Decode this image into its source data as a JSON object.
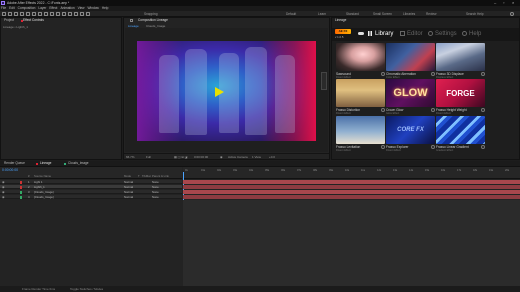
{
  "window": {
    "title": "Adobe After Effects 2022 - C:\\Fonts.aep *"
  },
  "menu": [
    "File",
    "Edit",
    "Composition",
    "Layer",
    "Effect",
    "Animation",
    "View",
    "Window",
    "Help"
  ],
  "toolbar": {
    "snapping_label": "Snapping",
    "workspaces": [
      "Default",
      "Learn",
      "Standard",
      "Small Screen",
      "Libraries",
      "Review"
    ],
    "search_label": "Search Help"
  },
  "project_panel": {
    "tabs": [
      "Project",
      "Effect Controls"
    ],
    "breadcrumb": "Lineage • Lighth_1"
  },
  "composition_panel": {
    "tab": "Composition Lineage",
    "sub_tabs": [
      "Lineage",
      "Clouds_Image"
    ],
    "zoom": "66.7%",
    "quality": "Full",
    "timecode": "0:00:00:00",
    "camera": "Active Camera",
    "views": "1 View",
    "exposure": "+0.0"
  },
  "library_panel": {
    "tab": "Lineage",
    "brand": "AE FX",
    "version": "v 1.0.5",
    "nav": [
      {
        "label": "Library",
        "active": true
      },
      {
        "label": "Editor",
        "active": false
      },
      {
        "label": "Settings",
        "active": false
      },
      {
        "label": "Help",
        "active": false
      }
    ],
    "cards": [
      {
        "title": "Sawsound",
        "sub": "Distort Effect"
      },
      {
        "title": "Chromatic Aberration",
        "sub": "Color Effect"
      },
      {
        "title": "Frasso 3D Displace",
        "sub": "Displace Effect"
      },
      {
        "title": "Frasso Distortion",
        "sub": "Distort Effect"
      },
      {
        "title": "Crown Glow",
        "sub": "Glow Effect"
      },
      {
        "title": "Frasso Height Weight",
        "sub": "Distort Effect"
      },
      {
        "title": "Frasso Levitation",
        "sub": "Distort Effect"
      },
      {
        "title": "Frasso Explorer",
        "sub": "Distort Effect"
      },
      {
        "title": "Frasso Linear Gradient",
        "sub": "Gradient Effect"
      }
    ],
    "card_text": {
      "glow": "GLOW",
      "forge": "FORGE",
      "core": "CORE FX"
    }
  },
  "timeline": {
    "tabs": [
      "Render Queue",
      "Lineage",
      "Clouds_Image"
    ],
    "timecode": "0:00:00:00",
    "columns": [
      "#",
      "Source Name",
      "Mode",
      "T",
      "TrkMat",
      "Parent & Link"
    ],
    "layers": [
      {
        "num": "1",
        "name": "Light 1",
        "mode": "Normal",
        "parent": "None"
      },
      {
        "num": "2",
        "name": "Lighth_1",
        "mode": "Normal",
        "parent": "None"
      },
      {
        "num": "3",
        "name": "[Clouds_Image]",
        "mode": "Normal",
        "parent": "None"
      },
      {
        "num": "4",
        "name": "[Clouds_Image]",
        "mode": "Normal",
        "parent": "None"
      }
    ],
    "ruler": [
      "0s",
      "01s",
      "02s",
      "03s",
      "04s",
      "05s",
      "06s",
      "07s",
      "08s",
      "09s",
      "10s",
      "11s",
      "12s",
      "13s",
      "14s",
      "15s",
      "16s",
      "17s",
      "18s",
      "19s",
      "20s"
    ],
    "colors": {
      "layer_track": "#a8474d",
      "layer_track_alt": "#8d3b41"
    },
    "status_left": "Frame Render Time  0ms",
    "status_mid": "Toggle Switches / Modes"
  }
}
